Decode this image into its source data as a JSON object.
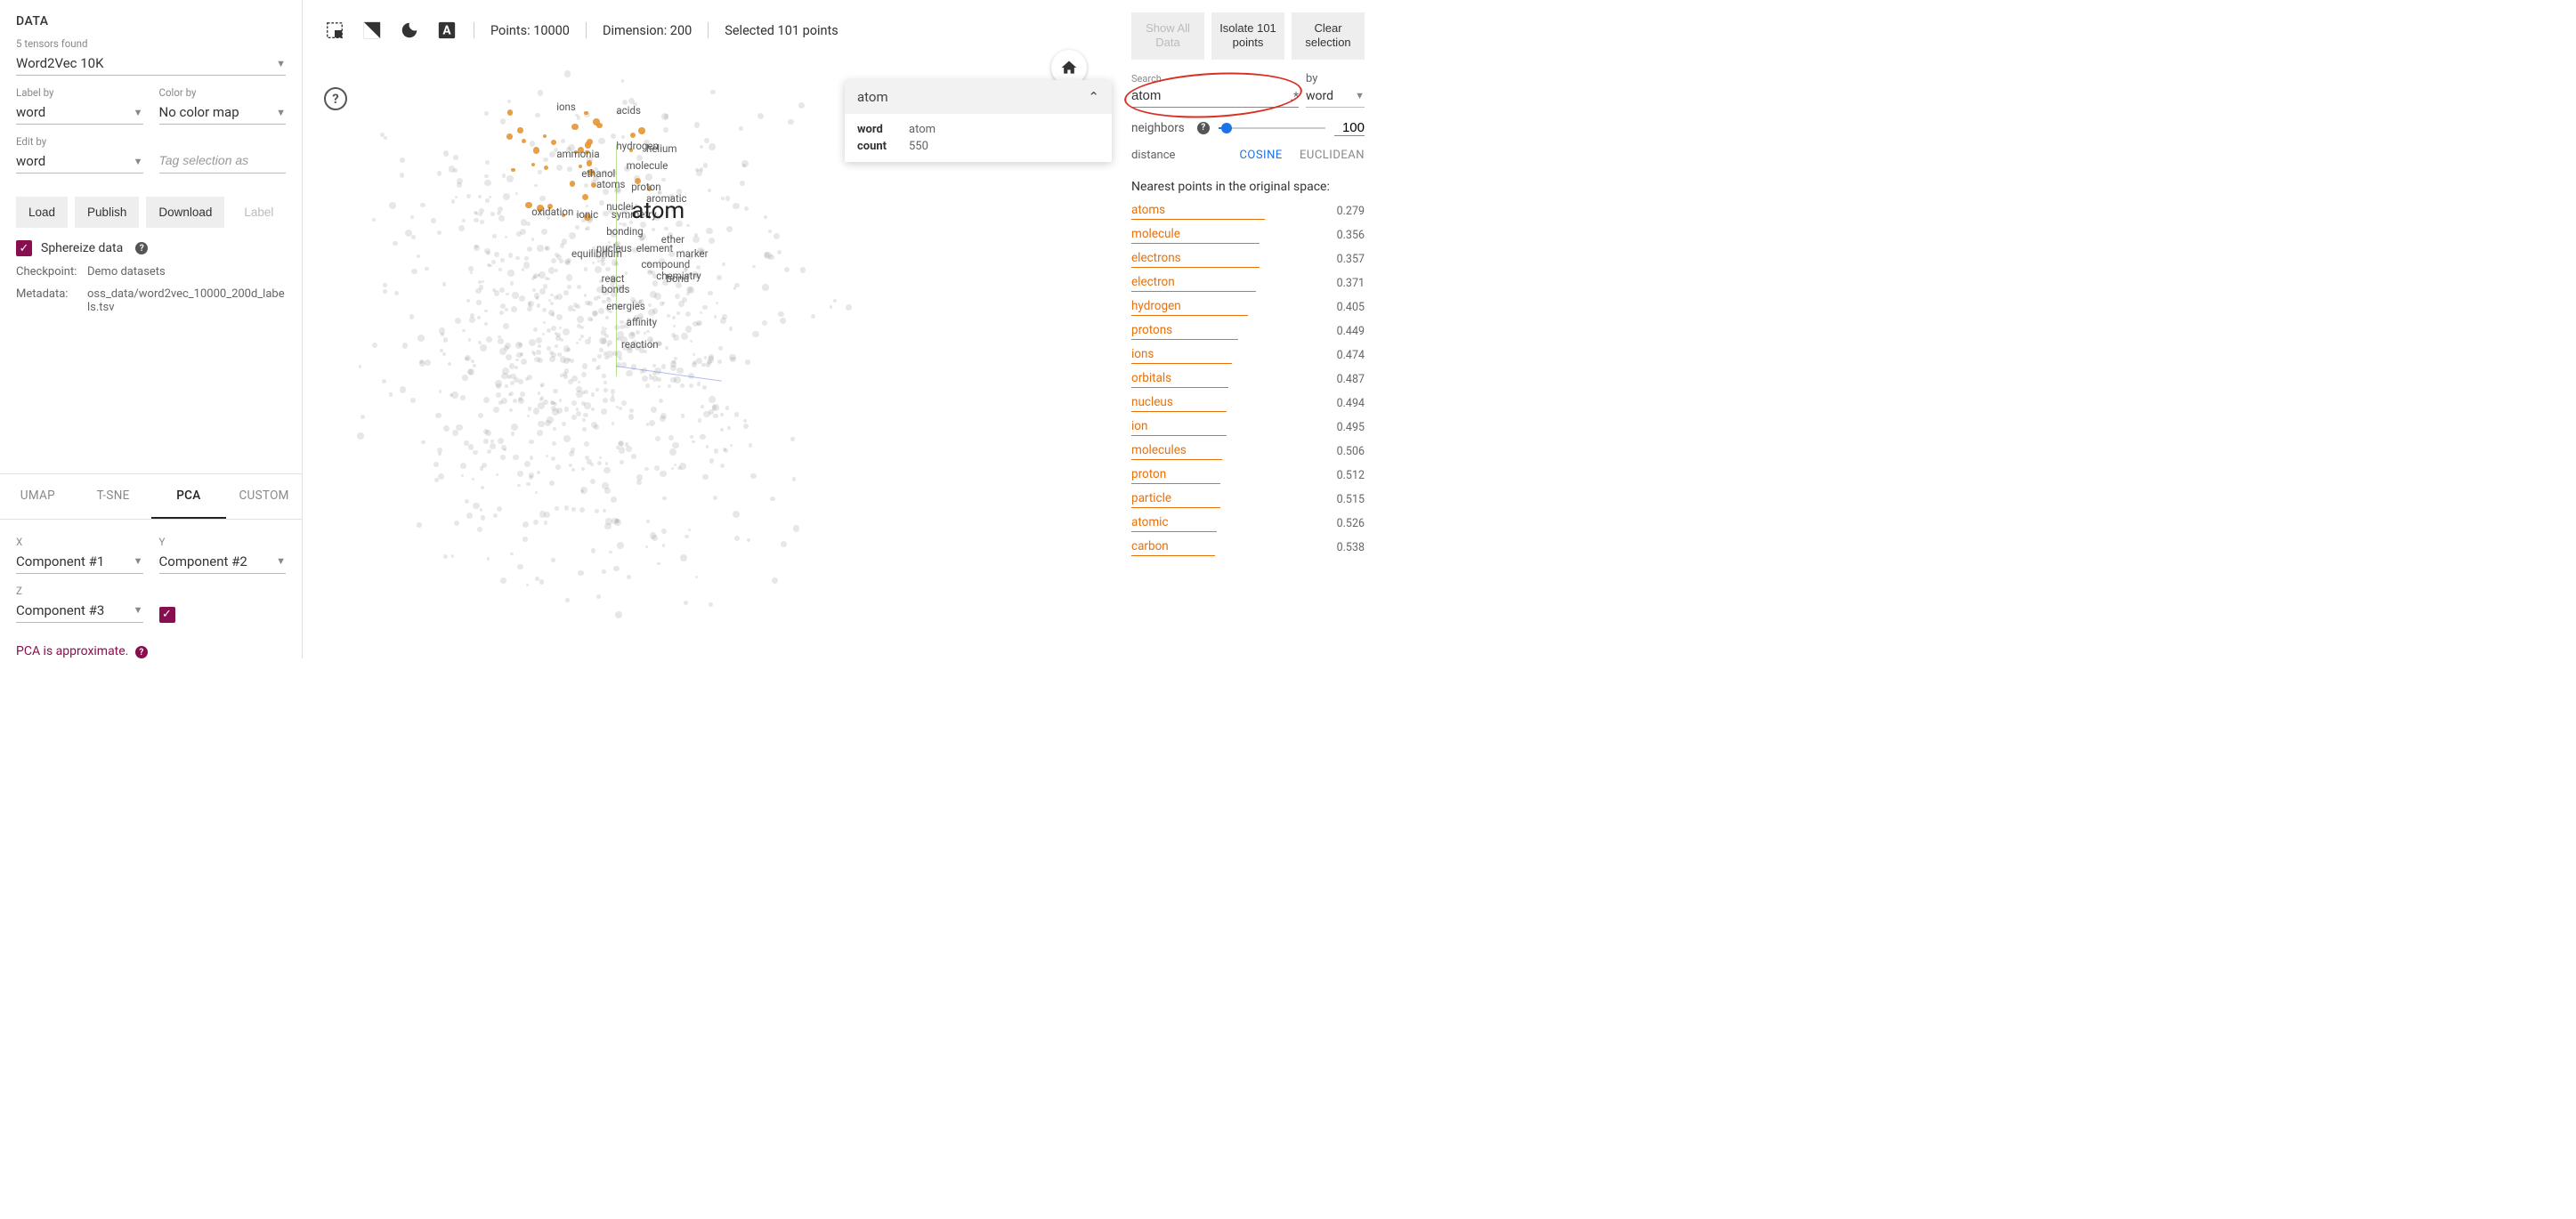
{
  "left": {
    "title": "DATA",
    "tensors_hint": "5 tensors found",
    "tensor": "Word2Vec 10K",
    "label_by_label": "Label by",
    "label_by": "word",
    "color_by_label": "Color by",
    "color_by": "No color map",
    "edit_by_label": "Edit by",
    "edit_by": "word",
    "tag_placeholder": "Tag selection as",
    "buttons": {
      "load": "Load",
      "publish": "Publish",
      "download": "Download",
      "label": "Label"
    },
    "sphereize": "Sphereize data",
    "checkpoint_k": "Checkpoint:",
    "checkpoint_v": "Demo datasets",
    "metadata_k": "Metadata:",
    "metadata_v": "oss_data/word2vec_10000_200d_labels.tsv",
    "tabs": {
      "umap": "UMAP",
      "tsne": "T-SNE",
      "pca": "PCA",
      "custom": "CUSTOM"
    },
    "pca": {
      "x_label": "X",
      "x": "Component #1",
      "y_label": "Y",
      "y": "Component #2",
      "z_label": "Z",
      "z": "Component #3",
      "note": "PCA is approximate."
    }
  },
  "center": {
    "points": "Points: 10000",
    "dimension": "Dimension: 200",
    "selected": "Selected 101 points",
    "main_label": "atom",
    "labels": [
      "ions",
      "acids",
      "hydrogen",
      "helium",
      "ammonia",
      "ethanol",
      "molecule",
      "atoms",
      "proton",
      "aromatic",
      "oxidation",
      "nuclei",
      "ionic",
      "symmetry",
      "bonding",
      "nucleus",
      "element",
      "ether",
      "equilibrium",
      "compound",
      "marker",
      "chemistry",
      "react",
      "bond",
      "bonds",
      "energies",
      "affinity",
      "reaction"
    ],
    "tooltip_title": "atom",
    "tooltip": {
      "word_k": "word",
      "word_v": "atom",
      "count_k": "count",
      "count_v": "550"
    }
  },
  "right": {
    "show_all": "Show All Data",
    "isolate": "Isolate 101 points",
    "clear": "Clear selection",
    "search_label": "Search",
    "search_value": "atom",
    "by_label": "by",
    "by_value": "word",
    "neighbors_label": "neighbors",
    "neighbors_value": "100",
    "distance_label": "distance",
    "cosine": "COSINE",
    "euclidean": "EUCLIDEAN",
    "nn_title": "Nearest points in the original space:",
    "nn": [
      {
        "word": "atoms",
        "dist": "0.279",
        "bar": 69
      },
      {
        "word": "molecule",
        "dist": "0.356",
        "bar": 66
      },
      {
        "word": "electrons",
        "dist": "0.357",
        "bar": 66
      },
      {
        "word": "electron",
        "dist": "0.371",
        "bar": 64
      },
      {
        "word": "hydrogen",
        "dist": "0.405",
        "bar": 60
      },
      {
        "word": "protons",
        "dist": "0.449",
        "bar": 55
      },
      {
        "word": "ions",
        "dist": "0.474",
        "bar": 52
      },
      {
        "word": "orbitals",
        "dist": "0.487",
        "bar": 50
      },
      {
        "word": "nucleus",
        "dist": "0.494",
        "bar": 49
      },
      {
        "word": "ion",
        "dist": "0.495",
        "bar": 49
      },
      {
        "word": "molecules",
        "dist": "0.506",
        "bar": 47
      },
      {
        "word": "proton",
        "dist": "0.512",
        "bar": 46
      },
      {
        "word": "particle",
        "dist": "0.515",
        "bar": 46
      },
      {
        "word": "atomic",
        "dist": "0.526",
        "bar": 44
      },
      {
        "word": "carbon",
        "dist": "0.538",
        "bar": 43
      }
    ]
  }
}
